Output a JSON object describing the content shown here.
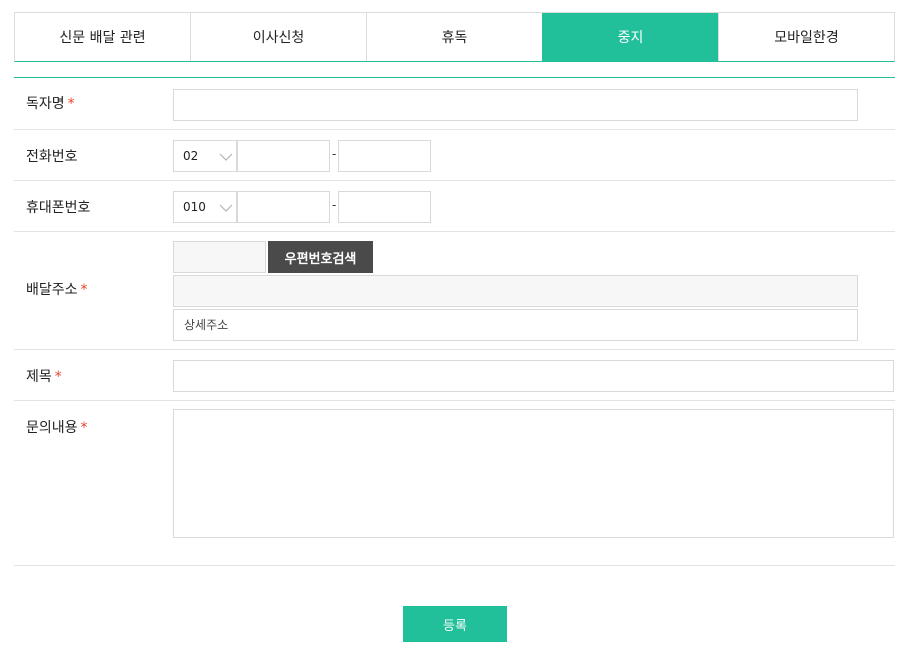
{
  "tabs": [
    {
      "label": "신문 배달 관련",
      "active": false
    },
    {
      "label": "이사신청",
      "active": false
    },
    {
      "label": "휴독",
      "active": false
    },
    {
      "label": "중지",
      "active": true
    },
    {
      "label": "모바일한경",
      "active": false
    }
  ],
  "form": {
    "reader_name": {
      "label": "독자명",
      "required_mark": "*",
      "value": ""
    },
    "phone": {
      "label": "전화번호",
      "area_code": "02",
      "middle": "",
      "last": "",
      "separator": "-"
    },
    "mobile": {
      "label": "휴대폰번호",
      "prefix": "010",
      "middle": "",
      "last": "",
      "separator": "-"
    },
    "address": {
      "label": "배달주소",
      "required_mark": "*",
      "zipcode": "",
      "search_button": "우편번호검색",
      "address1": "",
      "detail_placeholder": "상세주소"
    },
    "subject": {
      "label": "제목",
      "required_mark": "*",
      "value": ""
    },
    "content": {
      "label": "문의내용",
      "required_mark": "*",
      "value": ""
    }
  },
  "submit_label": "등록",
  "colors": {
    "accent": "#22c09a",
    "required": "#e8442e",
    "dark_button": "#4a4a4a"
  }
}
